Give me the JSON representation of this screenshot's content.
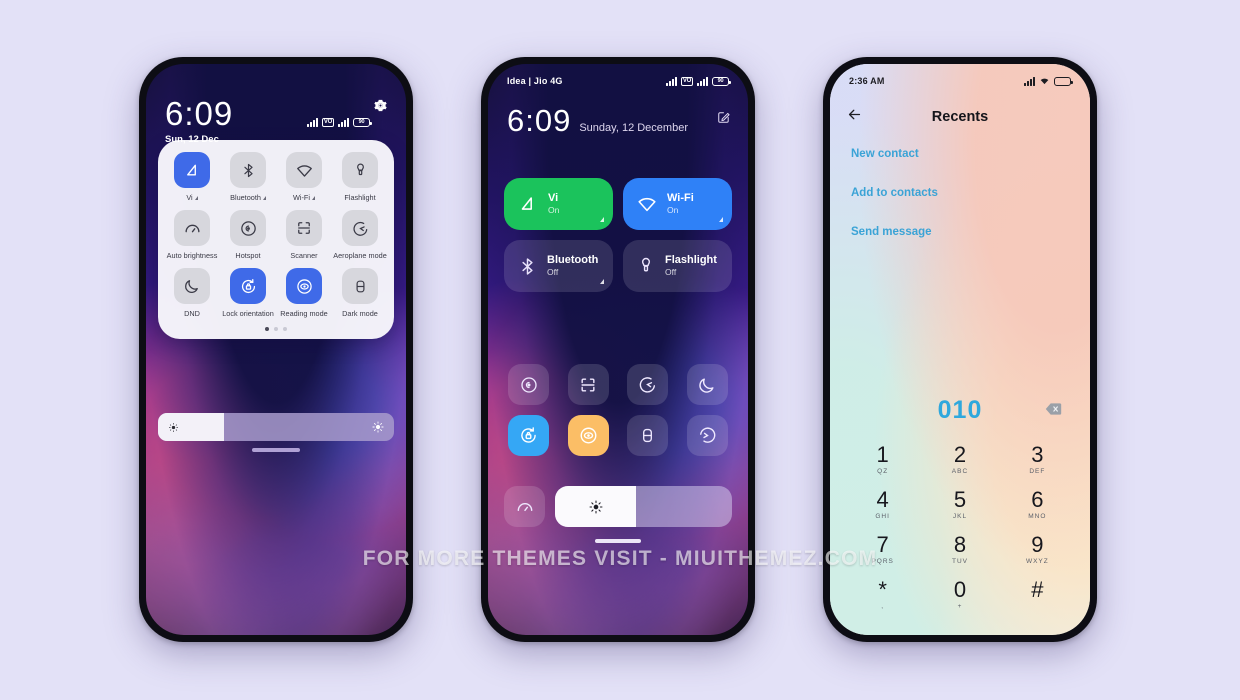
{
  "page": {
    "background_color": "#e3e1f7",
    "watermark": "FOR MORE THEMES VISIT - MIUITHEMEZ.COM"
  },
  "phone1": {
    "status": {
      "time": "6:09",
      "date": "Sun, 12 Dec",
      "battery_text": "90"
    },
    "tiles": [
      {
        "label": "Vi",
        "state": "on",
        "icon": "vi-icon",
        "expandable": true
      },
      {
        "label": "Bluetooth",
        "state": "off",
        "icon": "bluetooth-icon",
        "expandable": true
      },
      {
        "label": "Wi-Fi",
        "state": "off",
        "icon": "wifi-icon",
        "expandable": true
      },
      {
        "label": "Flashlight",
        "state": "off",
        "icon": "flashlight-icon",
        "expandable": false
      },
      {
        "label": "Auto brightness",
        "state": "off",
        "icon": "auto-brightness-icon",
        "expandable": false
      },
      {
        "label": "Hotspot",
        "state": "off",
        "icon": "hotspot-icon",
        "expandable": false
      },
      {
        "label": "Scanner",
        "state": "off",
        "icon": "scanner-icon",
        "expandable": false
      },
      {
        "label": "Aeroplane mode",
        "state": "off",
        "icon": "aeroplane-mode-icon",
        "expandable": false
      },
      {
        "label": "DND",
        "state": "off",
        "icon": "dnd-moon-icon",
        "expandable": false
      },
      {
        "label": "Lock orientation",
        "state": "on",
        "icon": "lock-orientation-icon",
        "expandable": false
      },
      {
        "label": "Reading mode",
        "state": "on",
        "icon": "reading-mode-eye-icon",
        "expandable": false
      },
      {
        "label": "Dark mode",
        "state": "off",
        "icon": "dark-mode-icon",
        "expandable": false
      }
    ],
    "page_dots": {
      "count": 3,
      "active": 0
    },
    "brightness": {
      "value_percent": 28,
      "low_icon": "brightness-low-icon",
      "high_icon": "brightness-high-icon"
    }
  },
  "phone2": {
    "status": {
      "carrier": "Idea | Jio 4G",
      "battery_text": "90"
    },
    "header": {
      "time": "6:09",
      "date": "Sunday, 12 December",
      "edit_icon": "edit-pencil-icon"
    },
    "big_tiles": [
      {
        "name": "Vi",
        "state": "On",
        "color": "#1bc35c",
        "icon": "vi-icon"
      },
      {
        "name": "Wi-Fi",
        "state": "On",
        "color": "#2f81f7",
        "icon": "wifi-icon"
      },
      {
        "name": "Bluetooth",
        "state": "Off",
        "color": "rgba(255,255,255,0.13)",
        "icon": "bluetooth-icon"
      },
      {
        "name": "Flashlight",
        "state": "Off",
        "color": "rgba(255,255,255,0.13)",
        "icon": "flashlight-icon"
      }
    ],
    "small_tiles": [
      {
        "icon": "hotspot-icon",
        "state": "off"
      },
      {
        "icon": "scanner-icon",
        "state": "off"
      },
      {
        "icon": "aeroplane-mode-icon",
        "state": "off"
      },
      {
        "icon": "dnd-moon-icon",
        "state": "off"
      },
      {
        "icon": "lock-orientation-icon",
        "state": "on",
        "color": "#35a7f5"
      },
      {
        "icon": "reading-mode-eye-icon",
        "state": "on",
        "color": "#fbbe66"
      },
      {
        "icon": "dark-mode-icon",
        "state": "off"
      },
      {
        "icon": "screen-cast-icon",
        "state": "off"
      }
    ],
    "extra_tile": {
      "icon": "auto-brightness-icon",
      "state": "off"
    },
    "brightness": {
      "value_percent": 46,
      "icon": "brightness-high-icon"
    }
  },
  "phone3": {
    "status": {
      "time": "2:36 AM",
      "icons": [
        "signal-icon",
        "wifi-icon",
        "battery-icon"
      ]
    },
    "header": {
      "title": "Recents",
      "back_icon": "back-arrow-icon"
    },
    "actions": [
      "New contact",
      "Add to contacts",
      "Send message"
    ],
    "dialed_number": "010",
    "delete_icon": "backspace-icon",
    "accent_color": "#2fa8dd",
    "keys": [
      {
        "digit": "1",
        "sub": "QZ"
      },
      {
        "digit": "2",
        "sub": "ABC"
      },
      {
        "digit": "3",
        "sub": "DEF"
      },
      {
        "digit": "4",
        "sub": "GHI"
      },
      {
        "digit": "5",
        "sub": "JKL"
      },
      {
        "digit": "6",
        "sub": "MNO"
      },
      {
        "digit": "7",
        "sub": "PQRS"
      },
      {
        "digit": "8",
        "sub": "TUV"
      },
      {
        "digit": "9",
        "sub": "WXYZ"
      },
      {
        "digit": "*",
        "sub": ","
      },
      {
        "digit": "0",
        "sub": "+"
      },
      {
        "digit": "#",
        "sub": ""
      }
    ],
    "nav": {
      "menu_icon": "menu-lines-icon",
      "call_icon": "call-handset-icon",
      "keypad_icon": "keypad-dots-icon"
    }
  }
}
